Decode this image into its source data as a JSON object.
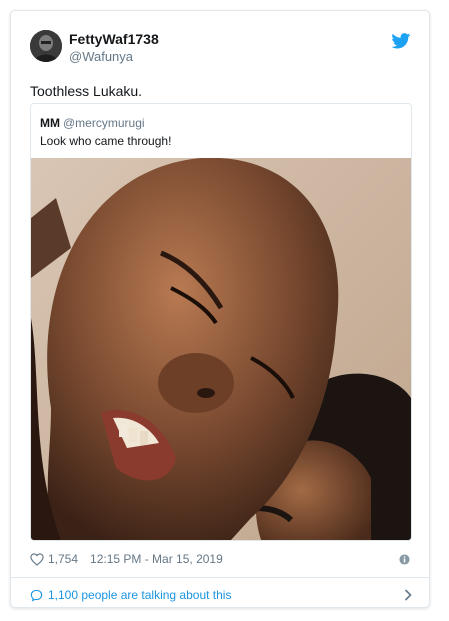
{
  "tweet": {
    "display_name": "FettyWaf1738",
    "handle": "@Wafunya",
    "text": "Toothless Lukaku.",
    "likes": "1,754",
    "timestamp": "12:15 PM - Mar 15, 2019",
    "talking": "1,100 people are talking about this"
  },
  "quoted": {
    "display_name": "MM",
    "handle": "@mercymurugi",
    "text": "Look who came through!"
  },
  "colors": {
    "twitter_blue": "#1da1f2",
    "link_blue": "#1b95e0",
    "muted_gray": "#657786",
    "border": "#e1e8ed"
  },
  "icons": [
    "twitter-bird-icon",
    "heart-icon",
    "info-icon",
    "speech-bubble-icon",
    "chevron-right-icon"
  ]
}
